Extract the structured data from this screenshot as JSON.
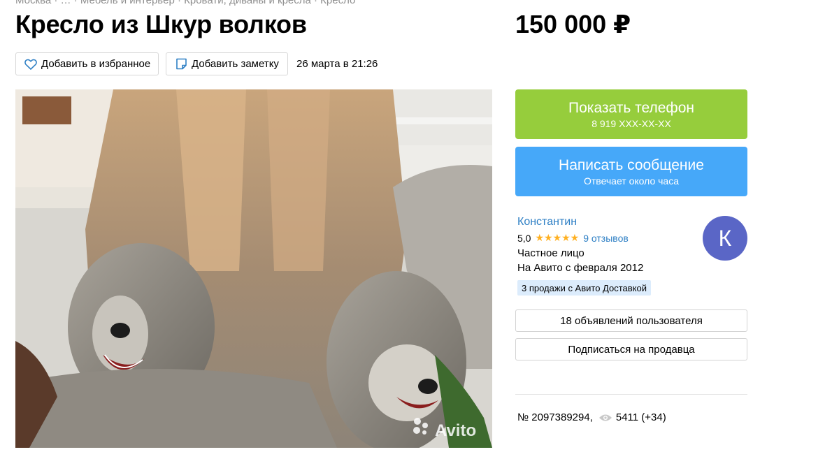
{
  "breadcrumbs": "Москва · … · Мебель и интерьер · Кровати, диваны и кресла · Кресло",
  "listing": {
    "title": "Кресло из Шкур волков",
    "price": "150 000 ₽",
    "date": "26 марта в 21:26",
    "favorite_label": "Добавить в избранное",
    "note_label": "Добавить заметку",
    "photo_watermark": "Avito",
    "id": "№ 2097389294,",
    "views": "5411 (+34)"
  },
  "actions": {
    "phone_label": "Показать телефон",
    "phone_number": "8 919 XXX-XX-XX",
    "message_label": "Написать сообщение",
    "message_sub": "Отвечает около часа"
  },
  "seller": {
    "name": "Константин",
    "rating": "5,0",
    "stars": "★★★★★",
    "reviews": "9 отзывов",
    "type": "Частное лицо",
    "since": "На Авито с февраля 2012",
    "badge": "3 продажи с Авито Доставкой",
    "avatar_letter": "К",
    "ads_label": "18 объявлений пользователя",
    "subscribe_label": "Подписаться на продавца"
  },
  "colors": {
    "phone_button": "#96cd3c",
    "message_button": "#46a8f9",
    "link": "#2f80c5",
    "avatar": "#5a66c6",
    "stars": "#ffb021",
    "badge": "#dcecfc"
  },
  "icons": {
    "favorite": "heart-icon",
    "note": "note-icon",
    "views": "eye-icon"
  }
}
